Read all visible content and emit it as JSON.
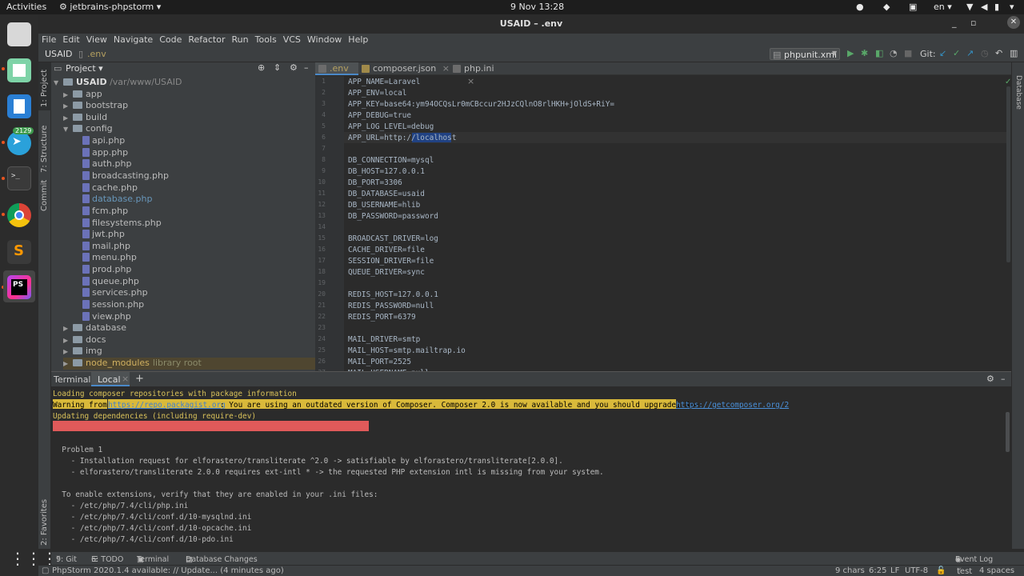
{
  "topbar": {
    "activities": "Activities",
    "app_name": "jetbrains-phpstorm",
    "clock": "9 Nov  13:28",
    "lang": "en"
  },
  "dock": {
    "telegram_badge": "2129",
    "apps": [
      "files-icon",
      "blank-app-icon",
      "writer-icon",
      "telegram-icon",
      "terminal-icon",
      "chrome-icon",
      "sublime-icon",
      "phpstorm-icon",
      "app-grid-icon"
    ]
  },
  "window": {
    "title": "USAID – .env"
  },
  "menu": [
    "File",
    "Edit",
    "View",
    "Navigate",
    "Code",
    "Refactor",
    "Run",
    "Tools",
    "VCS",
    "Window",
    "Help"
  ],
  "nav": {
    "project": "USAID",
    "file": ".env",
    "run_config": "phpunit.xml",
    "git_label": "Git:"
  },
  "sidebar_tabs": {
    "project": "1: Project",
    "structure": "7: Structure",
    "commit": "Commit",
    "favorites": "2: Favorites",
    "database": "Database"
  },
  "project_panel": {
    "title": "Project",
    "root": {
      "name": "USAID",
      "path": "/var/www/USAID"
    },
    "folders_top": [
      "app",
      "bootstrap",
      "build",
      "config"
    ],
    "config_files": [
      "api.php",
      "app.php",
      "auth.php",
      "broadcasting.php",
      "cache.php",
      "database.php",
      "fcm.php",
      "filesystems.php",
      "jwt.php",
      "mail.php",
      "menu.php",
      "prod.php",
      "queue.php",
      "services.php",
      "session.php",
      "view.php"
    ],
    "folders_bottom": [
      "database",
      "docs",
      "img",
      "node_modules"
    ],
    "node_modules_note": "library root"
  },
  "editor": {
    "tabs": [
      ".env",
      "composer.json",
      "php.ini"
    ],
    "lines": [
      "APP_NAME=Laravel",
      "APP_ENV=local",
      "APP_KEY=base64:ym94OCQsLr0mCBccur2HJzCQlnO8rlHKH+jOldS+RiY=",
      "APP_DEBUG=true",
      "APP_LOG_LEVEL=debug",
      "APP_URL=http://localhost",
      "",
      "DB_CONNECTION=mysql",
      "DB_HOST=127.0.0.1",
      "DB_PORT=3306",
      "DB_DATABASE=usaid",
      "DB_USERNAME=hlib",
      "DB_PASSWORD=password",
      "",
      "BROADCAST_DRIVER=log",
      "CACHE_DRIVER=file",
      "SESSION_DRIVER=file",
      "QUEUE_DRIVER=sync",
      "",
      "REDIS_HOST=127.0.0.1",
      "REDIS_PASSWORD=null",
      "REDIS_PORT=6379",
      "",
      "MAIL_DRIVER=smtp",
      "MAIL_HOST=smtp.mailtrap.io",
      "MAIL_PORT=2525",
      "MAIL_USERNAME=null"
    ]
  },
  "terminal": {
    "title": "Terminal:",
    "tab": "Local",
    "add": "+",
    "lines": [
      "Loading composer repositories with package information",
      "Warning from ",
      "https://repo.packagist.org",
      ": You are using an outdated version of Composer. Composer 2.0 is now available and you should upgrade. See ",
      "https://getcomposer.org/2",
      "Updating dependencies (including require-dev)",
      "",
      "",
      "  Problem 1",
      "    - Installation request for elforastero/transliterate ^2.0 -> satisfiable by elforastero/transliterate[2.0.0].",
      "    - elforastero/transliterate 2.0.0 requires ext-intl * -> the requested PHP extension intl is missing from your system.",
      "",
      "  To enable extensions, verify that they are enabled in your .ini files:",
      "    - /etc/php/7.4/cli/php.ini",
      "    - /etc/php/7.4/cli/conf.d/10-mysqlnd.ini",
      "    - /etc/php/7.4/cli/conf.d/10-opcache.ini",
      "    - /etc/php/7.4/cli/conf.d/10-pdo.ini"
    ]
  },
  "bottom_tools": {
    "git": "9: Git",
    "todo": "6: TODO",
    "terminal": "Terminal",
    "db_changes": "Database Changes",
    "event_log": "Event Log"
  },
  "status": {
    "message": "PhpStorm 2020.1.4 available: // Update... (4 minutes ago)",
    "chars": "9 chars",
    "pos": "6:25",
    "eol": "LF",
    "enc": "UTF-8",
    "branch": "test",
    "indent": "4 spaces"
  },
  "colors": {
    "accent": "#214283",
    "warning_bg": "#d9b93a",
    "error_bg": "#e05a5a",
    "git_green": "#59a869"
  }
}
